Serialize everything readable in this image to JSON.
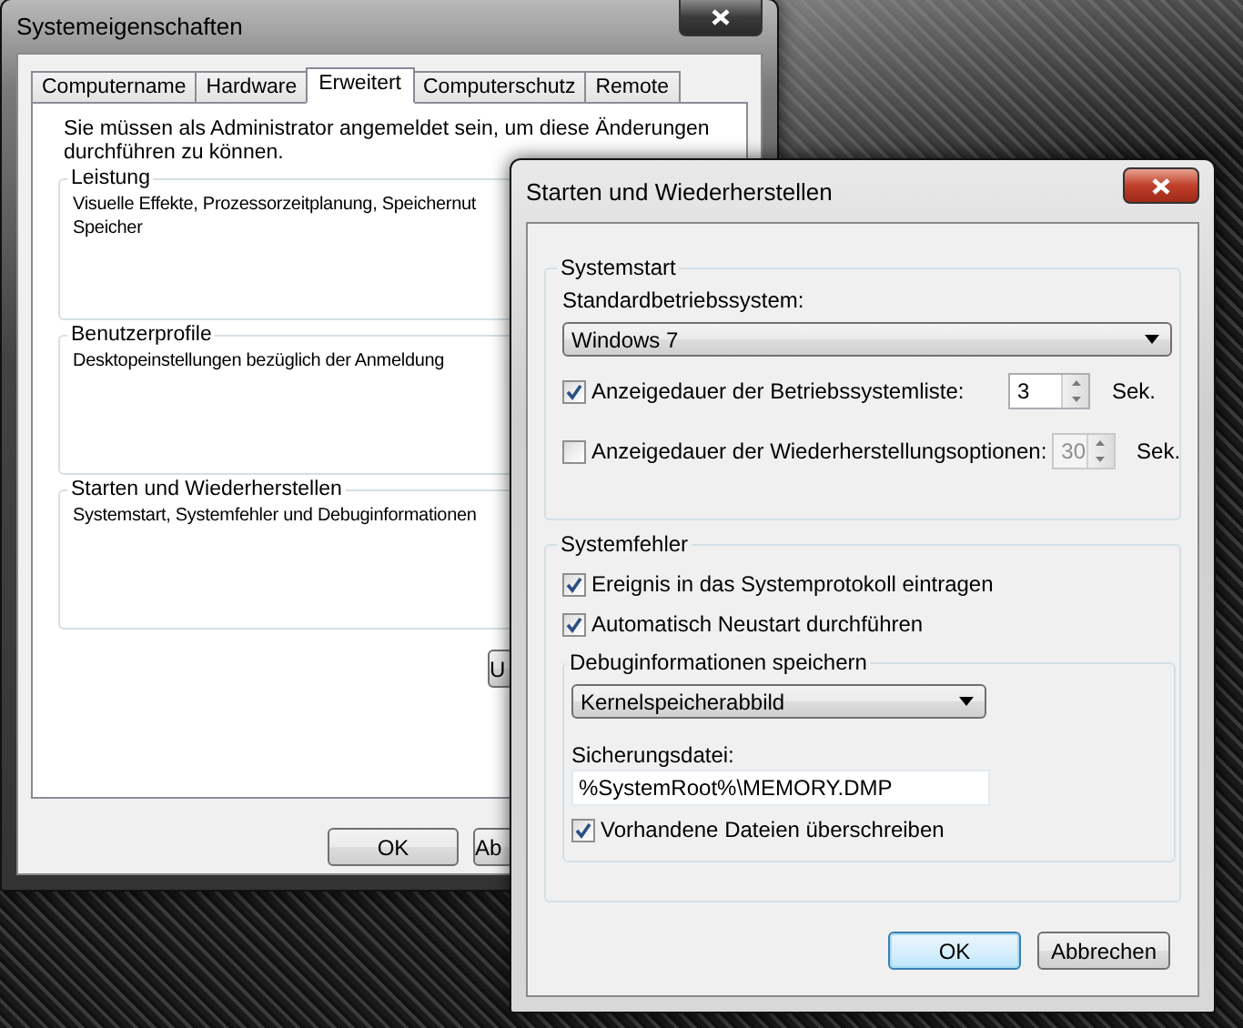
{
  "background_window": {
    "title": "Systemeigenschaften",
    "tabs": [
      {
        "label": "Computername",
        "selected": false
      },
      {
        "label": "Hardware",
        "selected": false
      },
      {
        "label": "Erweitert",
        "selected": true
      },
      {
        "label": "Computerschutz",
        "selected": false
      },
      {
        "label": "Remote",
        "selected": false
      }
    ],
    "admin_note": "Sie müssen als Administrator angemeldet sein, um diese Änderungen durchführen zu können.",
    "groups": [
      {
        "title": "Leistung",
        "lines": [
          "Visuelle Effekte, Prozessorzeitplanung, Speichernut",
          "Speicher"
        ]
      },
      {
        "title": "Benutzerprofile",
        "lines": [
          "Desktopeinstellungen bezüglich der Anmeldung"
        ]
      },
      {
        "title": "Starten und Wiederherstellen",
        "lines": [
          "Systemstart, Systemfehler und Debuginformationen"
        ]
      }
    ],
    "panel_button": "U",
    "buttons": [
      "OK",
      "Ab"
    ]
  },
  "dialog": {
    "title": "Starten und Wiederherstellen",
    "systemstart": {
      "title": "Systemstart",
      "os_label": "Standardbetriebssystem:",
      "os_value": "Windows 7",
      "timeouts": [
        {
          "label": "Anzeigedauer der Betriebssystemliste:",
          "checked": true,
          "value": "3",
          "unit": "Sek.",
          "disabled": false
        },
        {
          "label": "Anzeigedauer der Wiederherstellungsoptionen:",
          "checked": false,
          "value": "30",
          "unit": "Sek.",
          "disabled": true
        }
      ]
    },
    "systemfehler": {
      "title": "Systemfehler",
      "options": [
        {
          "label": "Ereignis in das Systemprotokoll eintragen",
          "checked": true
        },
        {
          "label": "Automatisch Neustart durchführen",
          "checked": true
        }
      ],
      "debug": {
        "title": "Debuginformationen speichern",
        "type_value": "Kernelspeicherabbild",
        "file_label": "Sicherungsdatei:",
        "file_value": "%SystemRoot%\\MEMORY.DMP",
        "overwrite": {
          "label": "Vorhandene Dateien überschreiben",
          "checked": true
        }
      }
    },
    "buttons": [
      {
        "label": "OK",
        "default": true
      },
      {
        "label": "Abbrechen",
        "default": false
      }
    ]
  }
}
